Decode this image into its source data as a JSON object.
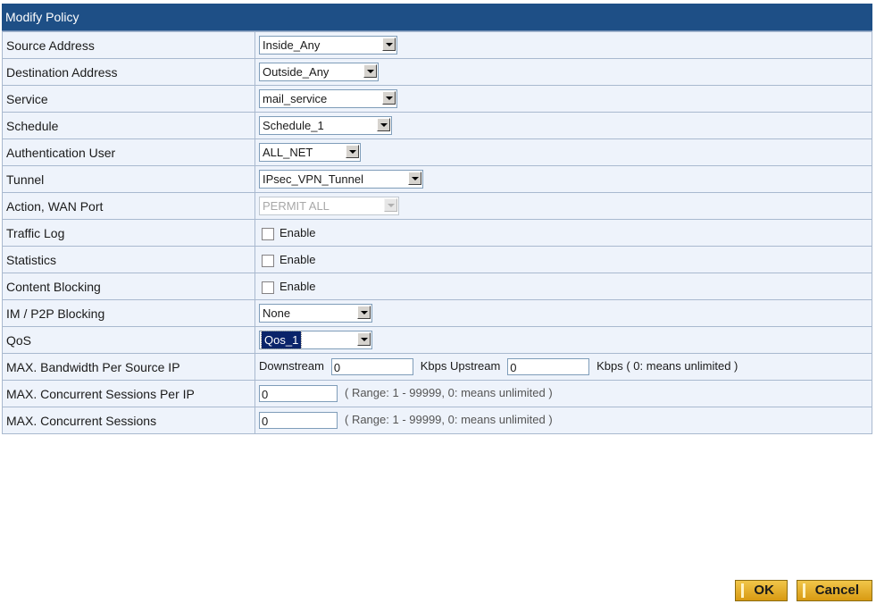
{
  "panel": {
    "title": "Modify Policy"
  },
  "rows": {
    "source_address": {
      "label": "Source Address",
      "value": "Inside_Any"
    },
    "destination_address": {
      "label": "Destination Address",
      "value": "Outside_Any"
    },
    "service": {
      "label": "Service",
      "value": "mail_service"
    },
    "schedule": {
      "label": "Schedule",
      "value": "Schedule_1"
    },
    "auth_user": {
      "label": "Authentication User",
      "value": "ALL_NET"
    },
    "tunnel": {
      "label": "Tunnel",
      "value": "IPsec_VPN_Tunnel"
    },
    "action_wan": {
      "label": "Action, WAN Port",
      "value": "PERMIT ALL"
    },
    "traffic_log": {
      "label": "Traffic Log",
      "checkbox_label": "Enable"
    },
    "statistics": {
      "label": "Statistics",
      "checkbox_label": "Enable"
    },
    "content_blocking": {
      "label": "Content Blocking",
      "checkbox_label": "Enable"
    },
    "im_p2p": {
      "label": "IM / P2P Blocking",
      "value": "None"
    },
    "qos": {
      "label": "QoS",
      "value": "Qos_1"
    },
    "max_bandwidth": {
      "label": "MAX. Bandwidth Per Source IP",
      "downstream_label": "Downstream",
      "downstream_value": "0",
      "mid_label": "Kbps Upstream",
      "upstream_value": "0",
      "hint": "Kbps ( 0: means unlimited )"
    },
    "max_sessions_per_ip": {
      "label": "MAX. Concurrent Sessions Per IP",
      "value": "0",
      "hint": "( Range: 1 - 99999, 0: means unlimited )"
    },
    "max_sessions": {
      "label": "MAX. Concurrent Sessions",
      "value": "0",
      "hint": "( Range: 1 - 99999, 0: means unlimited )"
    }
  },
  "buttons": {
    "ok": "OK",
    "cancel": "Cancel"
  },
  "colors": {
    "header": "#1e4f86",
    "row_bg": "#eef3fb",
    "button": "#e0a820"
  }
}
